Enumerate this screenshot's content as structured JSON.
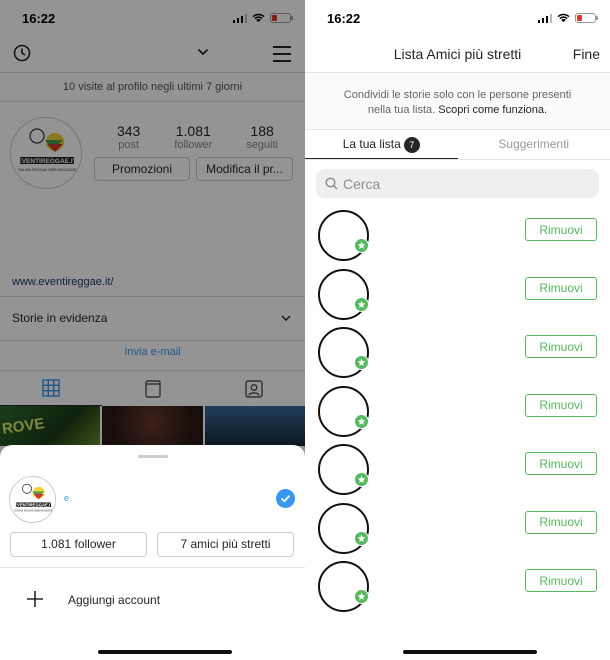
{
  "status": {
    "time": "16:22"
  },
  "left": {
    "visits_text": "10 visite al profilo negli ultimi 7 giorni",
    "logo_text": "EVENTIREGGAE.IT",
    "logo_subtext": "ITALIAN REGGAE WEB MAGAZINE",
    "stats": [
      {
        "value": "343",
        "label": "post"
      },
      {
        "value": "1.081",
        "label": "follower"
      },
      {
        "value": "188",
        "label": "seguiti"
      }
    ],
    "buttons": {
      "promo": "Promozioni",
      "edit": "Modifica il pr..."
    },
    "website": "www.eventireggae.it/",
    "highlights": "Storie in evidenza",
    "email_link": "Invia e-mail",
    "sheet": {
      "account_name": "e",
      "followers_btn": "1.081 follower",
      "close_friends_btn": "7 amici più stretti",
      "add_account": "Aggiungi account"
    },
    "thumb_label": "ROVE"
  },
  "right": {
    "title": "Lista Amici più stretti",
    "done": "Fine",
    "info_line1": "Condividi le storie solo con le persone presenti",
    "info_line2": "nella tua lista.",
    "info_link": "Scopri come funziona.",
    "tabs": {
      "list": "La tua lista",
      "count": "7",
      "suggestions": "Suggerimenti"
    },
    "search_placeholder": "Cerca",
    "remove_label": "Rimuovi",
    "friends_count": 7
  },
  "colors": {
    "accent_green": "#57b85e",
    "blue": "#3897f0"
  }
}
